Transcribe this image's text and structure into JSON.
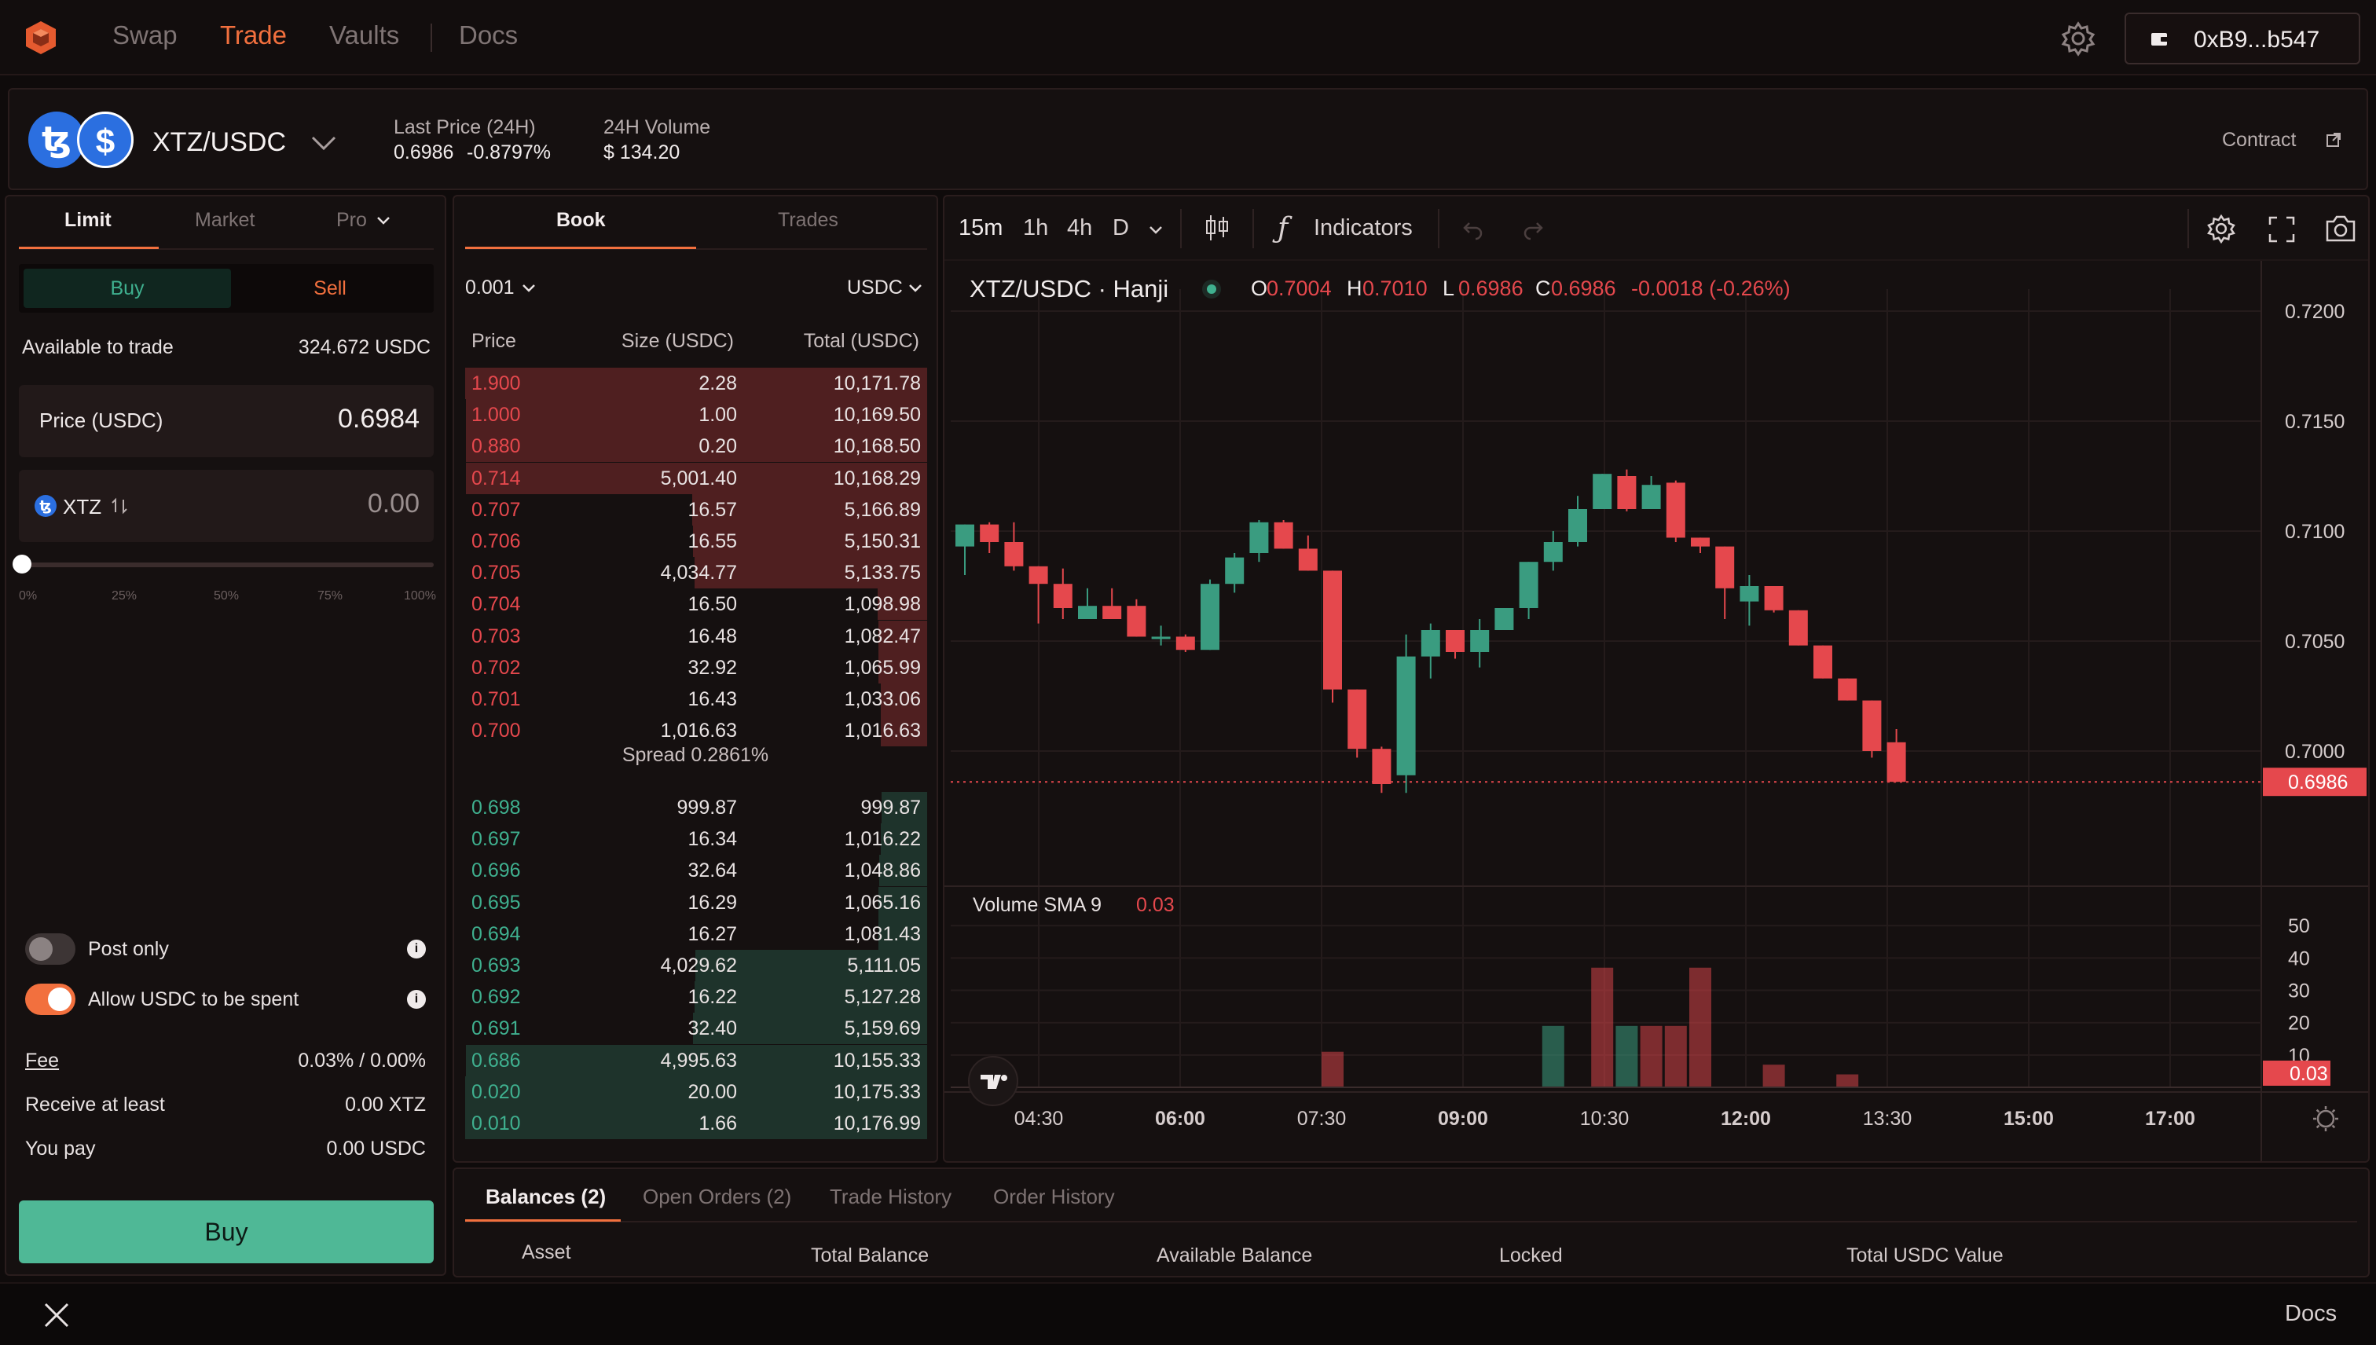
{
  "nav": {
    "links": [
      "Swap",
      "Trade",
      "Vaults",
      "Docs"
    ],
    "wallet": "0xB9...b547"
  },
  "market": {
    "pair": "XTZ/USDC",
    "last_price_label": "Last Price (24H)",
    "last_price": "0.6986",
    "last_change": "-0.8797%",
    "volume_label": "24H Volume",
    "volume": "$ 134.20",
    "contract": "Contract"
  },
  "order_form": {
    "tabs": [
      "Limit",
      "Market",
      "Pro"
    ],
    "buy": "Buy",
    "sell": "Sell",
    "available_label": "Available to trade",
    "available_value": "324.672 USDC",
    "price_label": "Price (USDC)",
    "price_value": "0.6984",
    "qty_token": "XTZ",
    "qty_value": "0.00",
    "slider_pct": [
      "0%",
      "25%",
      "50%",
      "75%",
      "100%"
    ],
    "slider_value": 0,
    "post_only": "Post only",
    "allow_spend": "Allow USDC to be spent",
    "fee_label": "Fee",
    "fee_value": "0.03% / 0.00%",
    "receive_label": "Receive at least",
    "receive_value": "0.00 XTZ",
    "pay_label": "You pay",
    "pay_value": "0.00 USDC",
    "submit": "Buy"
  },
  "book": {
    "tabs": [
      "Book",
      "Trades"
    ],
    "tick": "0.001",
    "unit": "USDC",
    "headers": [
      "Price",
      "Size (USDC)",
      "Total (USDC)"
    ],
    "asks": [
      {
        "p": "1.900",
        "s": "2.28",
        "t": "10,171.78",
        "depth": 1.0
      },
      {
        "p": "1.000",
        "s": "1.00",
        "t": "10,169.50",
        "depth": 0.999
      },
      {
        "p": "0.880",
        "s": "0.20",
        "t": "10,168.50",
        "depth": 0.998
      },
      {
        "p": "0.714",
        "s": "5,001.40",
        "t": "10,168.29",
        "depth": 0.998
      },
      {
        "p": "0.707",
        "s": "16.57",
        "t": "5,166.89",
        "depth": 0.508
      },
      {
        "p": "0.706",
        "s": "16.55",
        "t": "5,150.31",
        "depth": 0.506
      },
      {
        "p": "0.705",
        "s": "4,034.77",
        "t": "5,133.75",
        "depth": 0.504
      },
      {
        "p": "0.704",
        "s": "16.50",
        "t": "1,098.98",
        "depth": 0.108
      },
      {
        "p": "0.703",
        "s": "16.48",
        "t": "1,082.47",
        "depth": 0.106
      },
      {
        "p": "0.702",
        "s": "32.92",
        "t": "1,065.99",
        "depth": 0.105
      },
      {
        "p": "0.701",
        "s": "16.43",
        "t": "1,033.06",
        "depth": 0.101
      },
      {
        "p": "0.700",
        "s": "1,016.63",
        "t": "1,016.63",
        "depth": 0.1
      }
    ],
    "spread": "Spread 0.2861%",
    "bids": [
      {
        "p": "0.698",
        "s": "999.87",
        "t": "999.87",
        "depth": 0.098
      },
      {
        "p": "0.697",
        "s": "16.34",
        "t": "1,016.22",
        "depth": 0.1
      },
      {
        "p": "0.696",
        "s": "32.64",
        "t": "1,048.86",
        "depth": 0.103
      },
      {
        "p": "0.695",
        "s": "16.29",
        "t": "1,065.16",
        "depth": 0.105
      },
      {
        "p": "0.694",
        "s": "16.27",
        "t": "1,081.43",
        "depth": 0.106
      },
      {
        "p": "0.693",
        "s": "4,029.62",
        "t": "5,111.05",
        "depth": 0.502
      },
      {
        "p": "0.692",
        "s": "16.22",
        "t": "5,127.28",
        "depth": 0.504
      },
      {
        "p": "0.691",
        "s": "32.40",
        "t": "5,159.69",
        "depth": 0.507
      },
      {
        "p": "0.686",
        "s": "4,995.63",
        "t": "10,155.33",
        "depth": 0.998
      },
      {
        "p": "0.020",
        "s": "20.00",
        "t": "10,175.33",
        "depth": 1.0
      },
      {
        "p": "0.010",
        "s": "1.66",
        "t": "10,176.99",
        "depth": 1.0
      }
    ]
  },
  "chart_toolbar": {
    "intervals": [
      "15m",
      "1h",
      "4h",
      "D"
    ],
    "indicators": "Indicators"
  },
  "chart_data": {
    "type": "candlestick",
    "title": "XTZ/USDC · Hanji",
    "ohlc_label": {
      "o": "0.7004",
      "h": "0.7010",
      "l": "0.6986",
      "c": "0.6986",
      "chg": "-0.0018 (-0.26%)"
    },
    "y_ticks": [
      "0.7200",
      "0.7150",
      "0.7100",
      "0.7050",
      "0.7000"
    ],
    "ylim": [
      0.6955,
      0.7205
    ],
    "current_price": "0.6986",
    "current_price_value": 0.6986,
    "x_ticks": [
      "04:30",
      "06:00",
      "07:30",
      "09:00",
      "10:30",
      "12:00",
      "13:30",
      "15:00",
      "17:00"
    ],
    "candles": [
      {
        "o": 0.7093,
        "h": 0.7101,
        "l": 0.708,
        "c": 0.7103
      },
      {
        "o": 0.7103,
        "h": 0.7104,
        "l": 0.709,
        "c": 0.7095
      },
      {
        "o": 0.7095,
        "h": 0.7104,
        "l": 0.7082,
        "c": 0.7084
      },
      {
        "o": 0.7084,
        "h": 0.7082,
        "l": 0.7058,
        "c": 0.7076
      },
      {
        "o": 0.7076,
        "h": 0.7083,
        "l": 0.706,
        "c": 0.7065
      },
      {
        "o": 0.706,
        "h": 0.7074,
        "l": 0.706,
        "c": 0.7066
      },
      {
        "o": 0.7066,
        "h": 0.7074,
        "l": 0.706,
        "c": 0.706
      },
      {
        "o": 0.7066,
        "h": 0.7069,
        "l": 0.7052,
        "c": 0.7052
      },
      {
        "o": 0.7052,
        "h": 0.7057,
        "l": 0.7048,
        "c": 0.7052
      },
      {
        "o": 0.7052,
        "h": 0.7053,
        "l": 0.7045,
        "c": 0.7046
      },
      {
        "o": 0.7046,
        "h": 0.7078,
        "l": 0.7046,
        "c": 0.7076
      },
      {
        "o": 0.7076,
        "h": 0.709,
        "l": 0.7072,
        "c": 0.7088
      },
      {
        "o": 0.709,
        "h": 0.7105,
        "l": 0.7086,
        "c": 0.7104
      },
      {
        "o": 0.7104,
        "h": 0.7105,
        "l": 0.7092,
        "c": 0.7092
      },
      {
        "o": 0.7092,
        "h": 0.7098,
        "l": 0.7082,
        "c": 0.7082
      },
      {
        "o": 0.7082,
        "h": 0.7082,
        "l": 0.7022,
        "c": 0.7028
      },
      {
        "o": 0.7028,
        "h": 0.7023,
        "l": 0.6997,
        "c": 0.7001
      },
      {
        "o": 0.7001,
        "h": 0.7002,
        "l": 0.6981,
        "c": 0.6985
      },
      {
        "o": 0.6989,
        "h": 0.7053,
        "l": 0.6981,
        "c": 0.7043
      },
      {
        "o": 0.7043,
        "h": 0.7058,
        "l": 0.7033,
        "c": 0.7055
      },
      {
        "o": 0.7055,
        "h": 0.7055,
        "l": 0.7042,
        "c": 0.7045
      },
      {
        "o": 0.7045,
        "h": 0.706,
        "l": 0.7038,
        "c": 0.7055
      },
      {
        "o": 0.7055,
        "h": 0.7065,
        "l": 0.7055,
        "c": 0.7065
      },
      {
        "o": 0.7065,
        "h": 0.7086,
        "l": 0.706,
        "c": 0.7086
      },
      {
        "o": 0.7086,
        "h": 0.71,
        "l": 0.7082,
        "c": 0.7095
      },
      {
        "o": 0.7095,
        "h": 0.7116,
        "l": 0.7093,
        "c": 0.711
      },
      {
        "o": 0.711,
        "h": 0.7126,
        "l": 0.711,
        "c": 0.7126
      },
      {
        "o": 0.7125,
        "h": 0.7128,
        "l": 0.7109,
        "c": 0.711
      },
      {
        "o": 0.711,
        "h": 0.7125,
        "l": 0.711,
        "c": 0.7121
      },
      {
        "o": 0.7122,
        "h": 0.7123,
        "l": 0.7095,
        "c": 0.7097
      },
      {
        "o": 0.7097,
        "h": 0.7097,
        "l": 0.709,
        "c": 0.7093
      },
      {
        "o": 0.7093,
        "h": 0.7092,
        "l": 0.706,
        "c": 0.7074
      },
      {
        "o": 0.7068,
        "h": 0.708,
        "l": 0.7057,
        "c": 0.7075
      },
      {
        "o": 0.7075,
        "h": 0.7074,
        "l": 0.7063,
        "c": 0.7064
      },
      {
        "o": 0.7064,
        "h": 0.7062,
        "l": 0.7048,
        "c": 0.7048
      },
      {
        "o": 0.7048,
        "h": 0.7045,
        "l": 0.7033,
        "c": 0.7033
      },
      {
        "o": 0.7033,
        "h": 0.7033,
        "l": 0.7023,
        "c": 0.7023
      },
      {
        "o": 0.7023,
        "h": 0.702,
        "l": 0.6997,
        "c": 0.7
      },
      {
        "o": 0.7004,
        "h": 0.701,
        "l": 0.6986,
        "c": 0.6986
      }
    ],
    "volume_title": "Volume SMA 9",
    "volume_sma": "0.03",
    "volume_ticks": [
      "50",
      "40",
      "30",
      "20",
      "10"
    ],
    "volume_ylim": [
      0,
      52
    ],
    "volume_current": "0.03",
    "volume": [
      {
        "i": 15,
        "v": 11,
        "up": false
      },
      {
        "i": 24,
        "v": 19,
        "up": true
      },
      {
        "i": 26,
        "v": 37,
        "up": false
      },
      {
        "i": 27,
        "v": 19,
        "up": true
      },
      {
        "i": 28,
        "v": 19,
        "up": false
      },
      {
        "i": 29,
        "v": 19,
        "up": false
      },
      {
        "i": 30,
        "v": 37,
        "up": false
      },
      {
        "i": 33,
        "v": 7,
        "up": false
      },
      {
        "i": 36,
        "v": 4,
        "up": false
      }
    ]
  },
  "bottom": {
    "tabs": [
      "Balances (2)",
      "Open Orders (2)",
      "Trade History",
      "Order History"
    ],
    "columns": [
      "Asset",
      "Total Balance",
      "Available Balance",
      "Locked",
      "Total USDC Value"
    ]
  },
  "footer": {
    "docs": "Docs"
  },
  "colors": {
    "accent": "#f2703e",
    "green": "#3fb08f",
    "red": "#e5484d",
    "buy_button": "#4fb896"
  }
}
